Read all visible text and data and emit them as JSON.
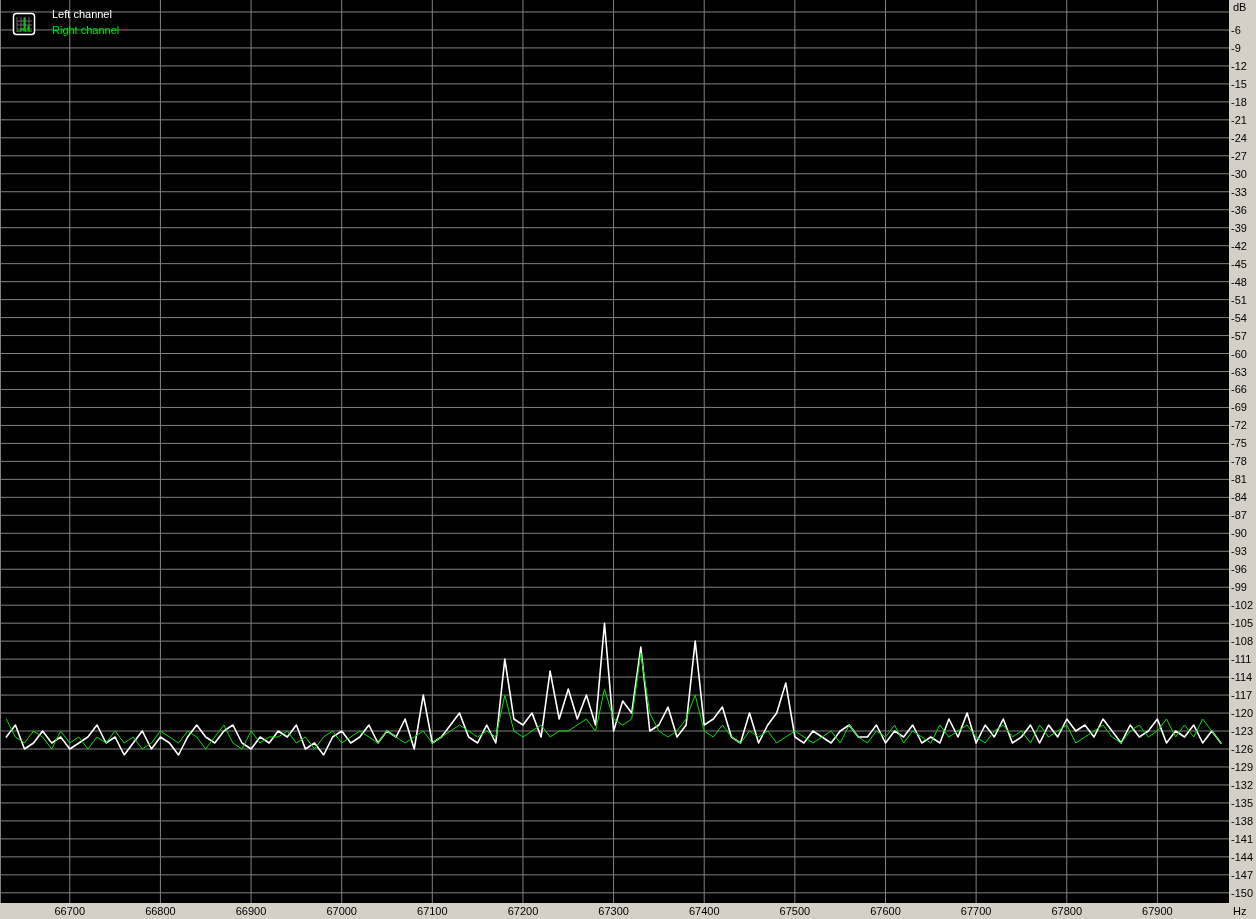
{
  "chart_data": {
    "type": "line",
    "grid": true,
    "xlabel": "Hz",
    "ylabel": "dB",
    "xlim": [
      66623,
      67979
    ],
    "ylim": [
      -151.7,
      -1
    ],
    "xticks": [
      66700,
      66800,
      66900,
      67000,
      67100,
      67200,
      67300,
      67400,
      67500,
      67600,
      67700,
      67800,
      67900
    ],
    "yticks": [
      -6,
      -9,
      -12,
      -15,
      -18,
      -21,
      -24,
      -27,
      -30,
      -33,
      -36,
      -39,
      -42,
      -45,
      -48,
      -51,
      -54,
      -57,
      -60,
      -63,
      -66,
      -69,
      -72,
      -75,
      -78,
      -81,
      -84,
      -87,
      -90,
      -93,
      -96,
      -99,
      -102,
      -105,
      -108,
      -111,
      -114,
      -117,
      -120,
      -123,
      -126,
      -129,
      -132,
      -135,
      -138,
      -141,
      -144,
      -147,
      -150
    ],
    "x": [
      66630,
      66640,
      66650,
      66660,
      66670,
      66680,
      66690,
      66700,
      66710,
      66720,
      66730,
      66740,
      66750,
      66760,
      66770,
      66780,
      66790,
      66800,
      66810,
      66820,
      66830,
      66840,
      66850,
      66860,
      66870,
      66880,
      66890,
      66900,
      66910,
      66920,
      66930,
      66940,
      66950,
      66960,
      66970,
      66980,
      66990,
      67000,
      67010,
      67020,
      67030,
      67040,
      67050,
      67060,
      67070,
      67080,
      67090,
      67100,
      67110,
      67120,
      67130,
      67140,
      67150,
      67160,
      67170,
      67180,
      67190,
      67200,
      67210,
      67220,
      67230,
      67240,
      67250,
      67260,
      67270,
      67280,
      67290,
      67300,
      67310,
      67320,
      67330,
      67340,
      67350,
      67360,
      67370,
      67380,
      67390,
      67400,
      67410,
      67420,
      67430,
      67440,
      67450,
      67460,
      67470,
      67480,
      67490,
      67500,
      67510,
      67520,
      67530,
      67540,
      67550,
      67560,
      67570,
      67580,
      67590,
      67600,
      67610,
      67620,
      67630,
      67640,
      67650,
      67660,
      67670,
      67680,
      67690,
      67700,
      67710,
      67720,
      67730,
      67740,
      67750,
      67760,
      67770,
      67780,
      67790,
      67800,
      67810,
      67820,
      67830,
      67840,
      67850,
      67860,
      67870,
      67880,
      67890,
      67900,
      67910,
      67920,
      67930,
      67940,
      67950,
      67960,
      67970
    ],
    "series": [
      {
        "name": "Left channel",
        "color": "#ffffff",
        "values": [
          -124,
          -122,
          -126,
          -125,
          -123,
          -125,
          -124,
          -126,
          -125,
          -124,
          -122,
          -125,
          -124,
          -127,
          -125,
          -123,
          -126,
          -124,
          -125,
          -127,
          -124,
          -122,
          -124,
          -125,
          -123,
          -122,
          -125,
          -126,
          -124,
          -125,
          -123,
          -124,
          -122,
          -126,
          -125,
          -127,
          -124,
          -123,
          -125,
          -124,
          -122,
          -125,
          -123,
          -124,
          -121,
          -126,
          -117,
          -125,
          -124,
          -122,
          -120,
          -124,
          -125,
          -122,
          -125,
          -111,
          -121,
          -122,
          -120,
          -124,
          -113,
          -121,
          -116,
          -121,
          -117,
          -122,
          -105,
          -123,
          -118,
          -120,
          -109,
          -123,
          -122,
          -119,
          -124,
          -122,
          -108,
          -122,
          -121,
          -119,
          -124,
          -125,
          -120,
          -125,
          -122,
          -120,
          -115,
          -124,
          -125,
          -123,
          -124,
          -125,
          -123,
          -122,
          -124,
          -124,
          -122,
          -125,
          -123,
          -124,
          -122,
          -125,
          -124,
          -125,
          -121,
          -124,
          -120,
          -125,
          -122,
          -124,
          -121,
          -125,
          -124,
          -122,
          -125,
          -122,
          -124,
          -121,
          -123,
          -122,
          -124,
          -121,
          -123,
          -125,
          -122,
          -124,
          -123,
          -121,
          -125,
          -123,
          -124,
          -122,
          -125,
          -123,
          -125
        ]
      },
      {
        "name": "Right channel",
        "color": "#00e000",
        "values": [
          -121,
          -124,
          -125,
          -123,
          -124,
          -126,
          -123,
          -125,
          -124,
          -126,
          -124,
          -125,
          -123,
          -125,
          -124,
          -126,
          -125,
          -123,
          -124,
          -125,
          -123,
          -124,
          -126,
          -124,
          -122,
          -125,
          -126,
          -123,
          -125,
          -124,
          -124,
          -123,
          -125,
          -124,
          -126,
          -124,
          -123,
          -125,
          -124,
          -123,
          -124,
          -125,
          -123,
          -124,
          -125,
          -124,
          -123,
          -125,
          -124,
          -123,
          -122,
          -123,
          -124,
          -123,
          -124,
          -117,
          -123,
          -124,
          -123,
          -122,
          -124,
          -123,
          -123,
          -122,
          -121,
          -123,
          -116,
          -121,
          -122,
          -121,
          -110,
          -120,
          -123,
          -124,
          -123,
          -121,
          -117,
          -123,
          -124,
          -122,
          -124,
          -125,
          -123,
          -124,
          -123,
          -125,
          -124,
          -123,
          -124,
          -125,
          -124,
          -123,
          -125,
          -122,
          -124,
          -125,
          -123,
          -124,
          -122,
          -125,
          -123,
          -124,
          -125,
          -122,
          -124,
          -123,
          -122,
          -124,
          -125,
          -123,
          -122,
          -124,
          -123,
          -125,
          -122,
          -124,
          -123,
          -122,
          -125,
          -124,
          -123,
          -122,
          -124,
          -125,
          -123,
          -122,
          -124,
          -123,
          -121,
          -124,
          -122,
          -124,
          -121,
          -123,
          -125
        ]
      }
    ]
  }
}
